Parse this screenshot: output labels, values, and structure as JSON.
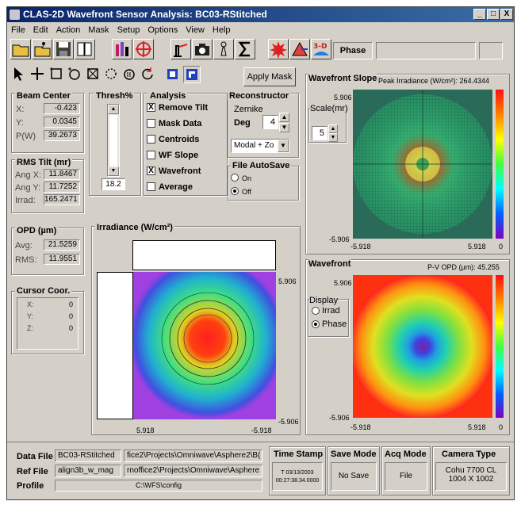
{
  "window": {
    "title": "CLAS-2D Wavefront Sensor Analysis: BC03-RStitched",
    "min_label": "_",
    "max_label": "□",
    "close_label": "X"
  },
  "menu": [
    "File",
    "Edit",
    "Action",
    "Mask",
    "Setup",
    "Options",
    "View",
    "Help"
  ],
  "toolbar": {
    "phase_label": "Phase",
    "apply_mask_label": "Apply Mask"
  },
  "beam_center": {
    "title": "Beam Center",
    "x_label": "X:",
    "x": "-0.423",
    "y_label": "Y:",
    "y": "0.0345",
    "p_label": "P(W)",
    "p": "39.2673"
  },
  "rms_tilt": {
    "title": "RMS Tilt (mr)",
    "angx_label": "Ang X:",
    "angx": "11.8467",
    "angy_label": "Ang Y:",
    "angy": "11.7252",
    "irrad_label": "Irrad:",
    "irrad": "165.2471"
  },
  "opd": {
    "title": "OPD (µm)",
    "avg_label": "Avg:",
    "avg": "21.5259",
    "rms_label": "RMS:",
    "rms": "11.9551"
  },
  "cursor": {
    "title": "Cursor Coor.",
    "x_label": "X:",
    "x": "0",
    "y_label": "Y:",
    "y": "0",
    "z_label": "Z:",
    "z": "0"
  },
  "thresh": {
    "title": "Thresh%",
    "value": "18.2"
  },
  "analysis": {
    "title": "Analysis",
    "items": [
      {
        "label": "Remove Tilt",
        "checked": "X"
      },
      {
        "label": "Mask Data",
        "checked": ""
      },
      {
        "label": "Centroids",
        "checked": ""
      },
      {
        "label": "WF Slope",
        "checked": ""
      },
      {
        "label": "Wavefront",
        "checked": "X"
      },
      {
        "label": "Average",
        "checked": ""
      }
    ]
  },
  "reconstructor": {
    "title": "Reconstructor",
    "zernike_label": "Zernike",
    "deg_label": "Deg",
    "deg": "4",
    "mode": "Modal + Zo"
  },
  "autosave": {
    "title": "File AutoSave",
    "on_label": "On",
    "off_label": "Off"
  },
  "irradiance": {
    "title": "Irradiance (W/cm²)",
    "top_right": "5.906",
    "bottom_right": "-5.906",
    "bottom_left": "5.918",
    "bottom_x_right": "-5.918"
  },
  "wf_slope": {
    "title": "Wavefront Slope",
    "peak": "Peak Irradiance (W/cm²): 264.4344",
    "scale_label": "Scale(mr)",
    "scale": "5",
    "ytop": "5.906",
    "ybot": "-5.906",
    "xleft": "-5.918",
    "xright": "5.918",
    "cbar_zero": "0"
  },
  "wavefront": {
    "title": "Wavefront",
    "pv": "P-V OPD (µm): 45.255",
    "display_label": "Display",
    "irrad_label": "Irrad",
    "phase_label": "Phase",
    "ytop": "5.906",
    "ybot": "-5.906",
    "xleft": "-5.918",
    "xright": "5.918",
    "cbar_zero": "0"
  },
  "status": {
    "data_file_label": "Data File",
    "data_file": "BC03-RStitched",
    "data_path": "fice2\\Projects\\Omniwave\\Asphere2\\B(",
    "ref_file_label": "Ref File",
    "ref_file": "align3b_w_mag",
    "ref_path": "rnoffice2\\Projects\\Omniwave\\Asphere",
    "profile_label": "Profile",
    "profile": "C:\\WFS\\config",
    "timestamp_title": "Time Stamp",
    "timestamp": "T 03/13/2003 00:27:38.34.0000",
    "save_mode_title": "Save Mode",
    "save_mode": "No Save",
    "acq_mode_title": "Acq Mode",
    "acq_mode": "File",
    "camera_title": "Camera Type",
    "camera_1": "Cohu 7700 CL",
    "camera_2": "1004 X 1002"
  }
}
